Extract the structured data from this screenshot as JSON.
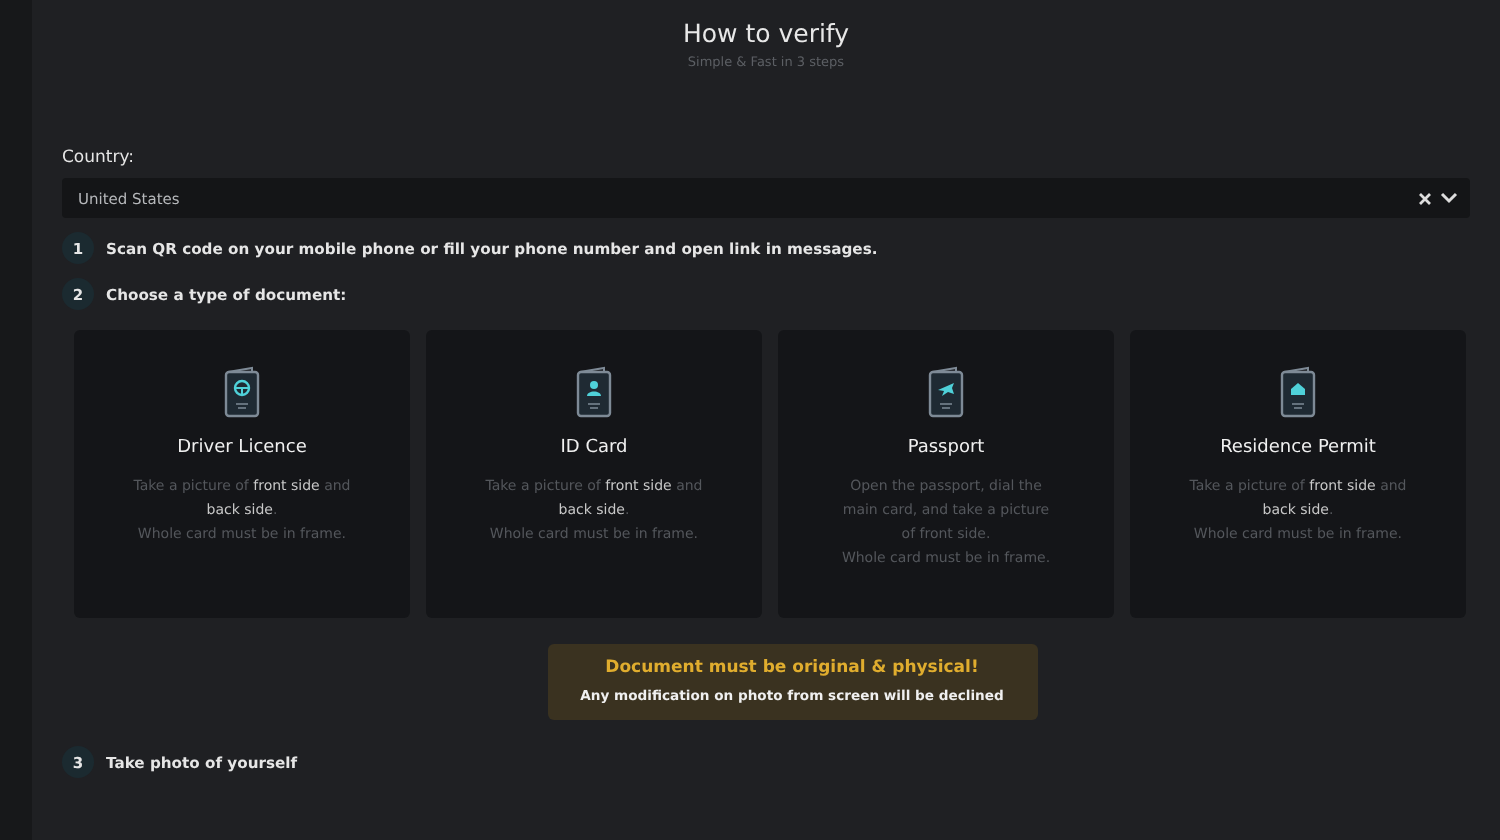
{
  "header": {
    "title": "How to verify",
    "subtitle": "Simple & Fast in 3 steps"
  },
  "country": {
    "label": "Country:",
    "value": "United States"
  },
  "steps": [
    {
      "number": "1",
      "text": "Scan QR code on your mobile phone or fill your phone number and open link in messages."
    },
    {
      "number": "2",
      "text": "Choose a type of document:"
    }
  ],
  "documents": [
    {
      "title": "Driver Licence",
      "description": "Take a picture of **front side** and\n**back side**.\nWhole card must be in frame."
    },
    {
      "title": "ID Card",
      "description": "Take a picture of **front side** and\n**back side**.\nWhole card must be in frame."
    },
    {
      "title": "Passport",
      "description": "Open the passport, dial the\nmain card, and take a picture\nof front side.\nWhole card must be in frame."
    },
    {
      "title": "Residence Permit",
      "description": "Take a picture of **front side** and\n**back side**.\nWhole card must be in frame."
    }
  ],
  "warning": {
    "title": "Document must be original & physical!",
    "text": "Any modification on photo from screen will be declined"
  },
  "final_step": {
    "number": "3",
    "text": "Take photo of yourself"
  }
}
